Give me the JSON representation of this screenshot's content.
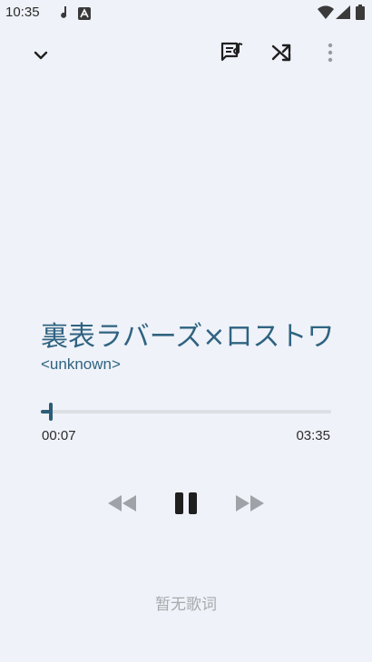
{
  "status_bar": {
    "time": "10:35",
    "icons": [
      "music-note-icon",
      "text-a-icon",
      "wifi-icon",
      "signal-icon",
      "battery-icon"
    ]
  },
  "toolbar": {
    "icons": [
      "chevron-down-icon",
      "playlist-icon",
      "shuffle-icon",
      "more-vert-icon"
    ]
  },
  "track": {
    "title": "裏表ラバーズ×ロストワ",
    "artist": "<unknown>"
  },
  "progress": {
    "current": "00:07",
    "total": "03:35",
    "fraction": 0.033
  },
  "controls": {
    "icons": [
      "rewind-icon",
      "pause-icon",
      "fast-forward-icon"
    ]
  },
  "lyrics": {
    "text": "暂无歌词"
  },
  "colors": {
    "background": "#eff2f8",
    "accent": "#2c5c77",
    "muted": "#a7a9ad"
  }
}
